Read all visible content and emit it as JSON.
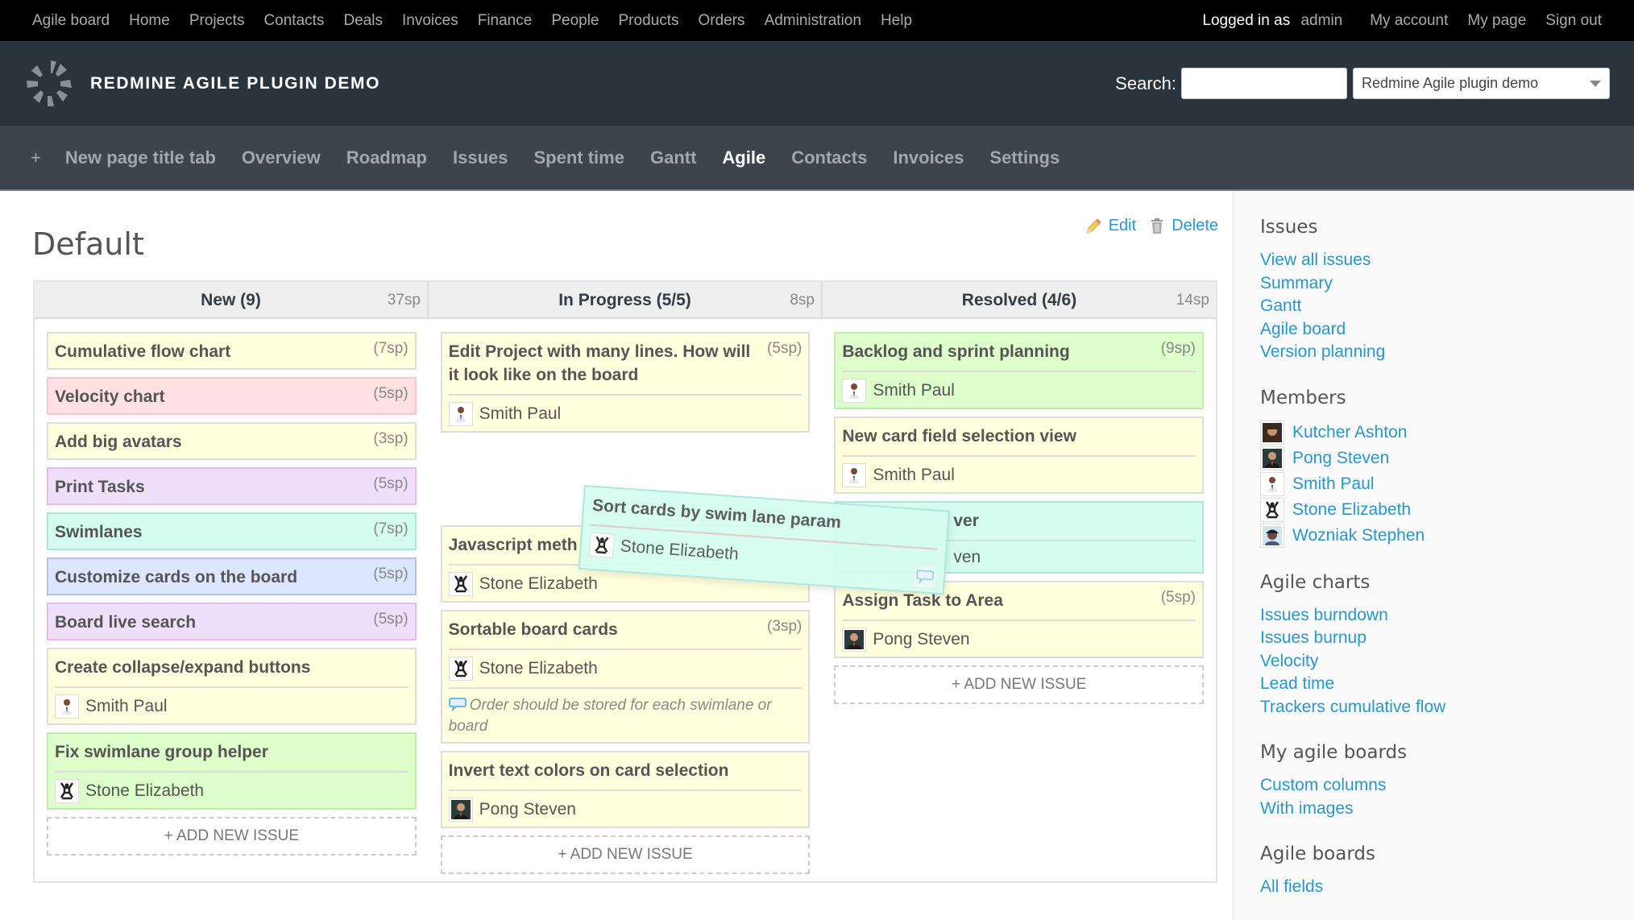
{
  "top_menu": {
    "left": [
      "Agile board",
      "Home",
      "Projects",
      "Contacts",
      "Deals",
      "Invoices",
      "Finance",
      "People",
      "Products",
      "Orders",
      "Administration",
      "Help"
    ],
    "logged_in_prefix": "Logged in as",
    "logged_in_user": "admin",
    "right": [
      "My account",
      "My page",
      "Sign out"
    ]
  },
  "header": {
    "title": "REDMINE AGILE PLUGIN DEMO",
    "search_label": "Search:",
    "search_value": "",
    "project_select": "Redmine Agile plugin demo"
  },
  "main_menu": {
    "plus": "+",
    "tabs": [
      "New page title tab",
      "Overview",
      "Roadmap",
      "Issues",
      "Spent time",
      "Gantt",
      "Agile",
      "Contacts",
      "Invoices",
      "Settings"
    ],
    "selected": "Agile"
  },
  "page": {
    "title": "Default",
    "edit_label": "Edit",
    "delete_label": "Delete",
    "add_issue_label": "+ ADD NEW ISSUE"
  },
  "board": {
    "columns": [
      {
        "title": "New (9)",
        "sp": "37sp",
        "cards": [
          {
            "title": "Cumulative flow chart",
            "sp": "(7sp)",
            "color": "yellow"
          },
          {
            "title": "Velocity chart",
            "sp": "(5sp)",
            "color": "red"
          },
          {
            "title": "Add big avatars",
            "sp": "(3sp)",
            "color": "yellow"
          },
          {
            "title": "Print Tasks",
            "sp": "(5sp)",
            "color": "purple"
          },
          {
            "title": "Swimlanes",
            "sp": "(7sp)",
            "color": "teal"
          },
          {
            "title": "Customize cards on the board",
            "sp": "(5sp)",
            "color": "blue"
          },
          {
            "title": "Board live search",
            "sp": "(5sp)",
            "color": "purple"
          },
          {
            "title": "Create collapse/expand buttons",
            "sp": "",
            "color": "yellow",
            "assignee": "Smith Paul"
          },
          {
            "title": "Fix swimlane group helper",
            "sp": "",
            "color": "green",
            "assignee": "Stone Elizabeth"
          }
        ]
      },
      {
        "title": "In Progress (5/5)",
        "sp": "8sp",
        "cards": [
          {
            "title": "Edit Project with many lines. How will it look like on the board",
            "sp": "(5sp)",
            "color": "yellow",
            "assignee": "Smith Paul"
          },
          {
            "title": "Javascript meth",
            "sp": "",
            "color": "yellow",
            "assignee": "Stone Elizabeth"
          },
          {
            "title": "Sortable board cards",
            "sp": "(3sp)",
            "color": "yellow",
            "assignee": "Stone Elizabeth",
            "note": "Order should be stored for each swimlane or board"
          },
          {
            "title": "Invert text colors on card selection",
            "sp": "",
            "color": "yellow",
            "assignee": "Pong Steven"
          }
        ]
      },
      {
        "title": "Resolved (4/6)",
        "sp": "14sp",
        "cards": [
          {
            "title": "Backlog and sprint planning",
            "sp": "(9sp)",
            "color": "green",
            "assignee": "Smith Paul"
          },
          {
            "title": "New card field selection view",
            "sp": "",
            "color": "yellow",
            "assignee": "Smith Paul"
          },
          {
            "title": "ver",
            "sp": "",
            "color": "teal",
            "assignee": "ven"
          },
          {
            "title": "Assign Task to Area",
            "sp": "(5sp)",
            "color": "yellow",
            "assignee": "Pong Steven"
          }
        ]
      }
    ],
    "dragging_card": {
      "title": "Sort cards by swim lane param",
      "assignee": "Stone Elizabeth",
      "color": "teal"
    }
  },
  "sidebar": {
    "issues": {
      "heading": "Issues",
      "links": [
        "View all issues",
        "Summary",
        "Gantt",
        "Agile board",
        "Version planning"
      ]
    },
    "members": {
      "heading": "Members",
      "list": [
        "Kutcher Ashton",
        "Pong Steven",
        "Smith Paul",
        "Stone Elizabeth",
        "Wozniak Stephen"
      ]
    },
    "agile_charts": {
      "heading": "Agile charts",
      "links": [
        "Issues burndown",
        "Issues burnup",
        "Velocity",
        "Lead time",
        "Trackers cumulative flow"
      ]
    },
    "my_agile_boards": {
      "heading": "My agile boards",
      "links": [
        "Custom columns",
        "With images"
      ]
    },
    "agile_boards": {
      "heading": "Agile boards",
      "links": [
        "All fields"
      ]
    }
  },
  "colors": {
    "link": "#2996cc",
    "top_bar": "#000000",
    "header": "#2a343c",
    "main_menu": "#3c444c"
  }
}
